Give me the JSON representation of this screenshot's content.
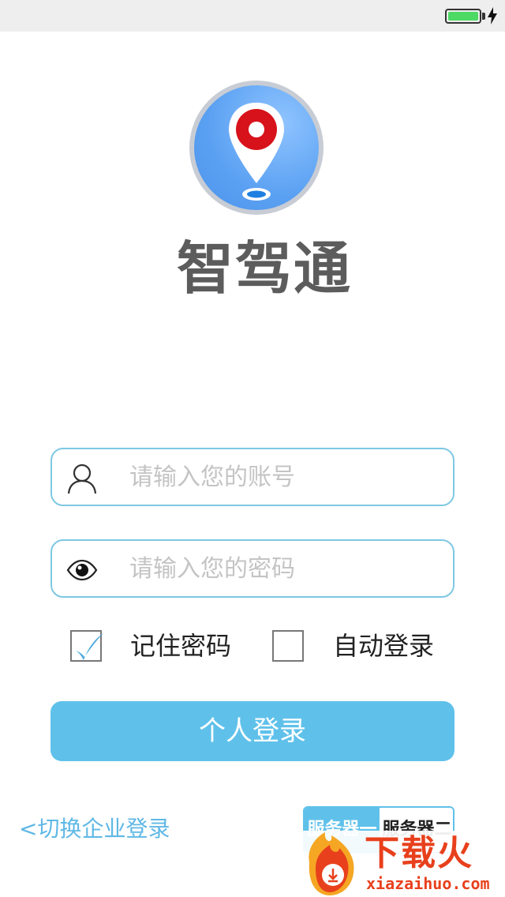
{
  "app": {
    "name": "智驾通"
  },
  "login": {
    "account_placeholder": "请输入您的账号",
    "password_placeholder": "请输入您的密码",
    "remember_label": "记住密码",
    "remember_checked": true,
    "auto_login_label": "自动登录",
    "auto_login_checked": false,
    "login_button": "个人登录",
    "switch_link": "<切换企业登录"
  },
  "server": {
    "options": [
      "服务器一",
      "服务器二"
    ],
    "selected": "服务器一"
  },
  "watermark": {
    "title": "下载火",
    "url": "xiazaihuo.com"
  },
  "colors": {
    "accent": "#5fc1ea",
    "field_border": "#7ec8e3",
    "battery": "#4cd964",
    "watermark": "#e8401c"
  }
}
